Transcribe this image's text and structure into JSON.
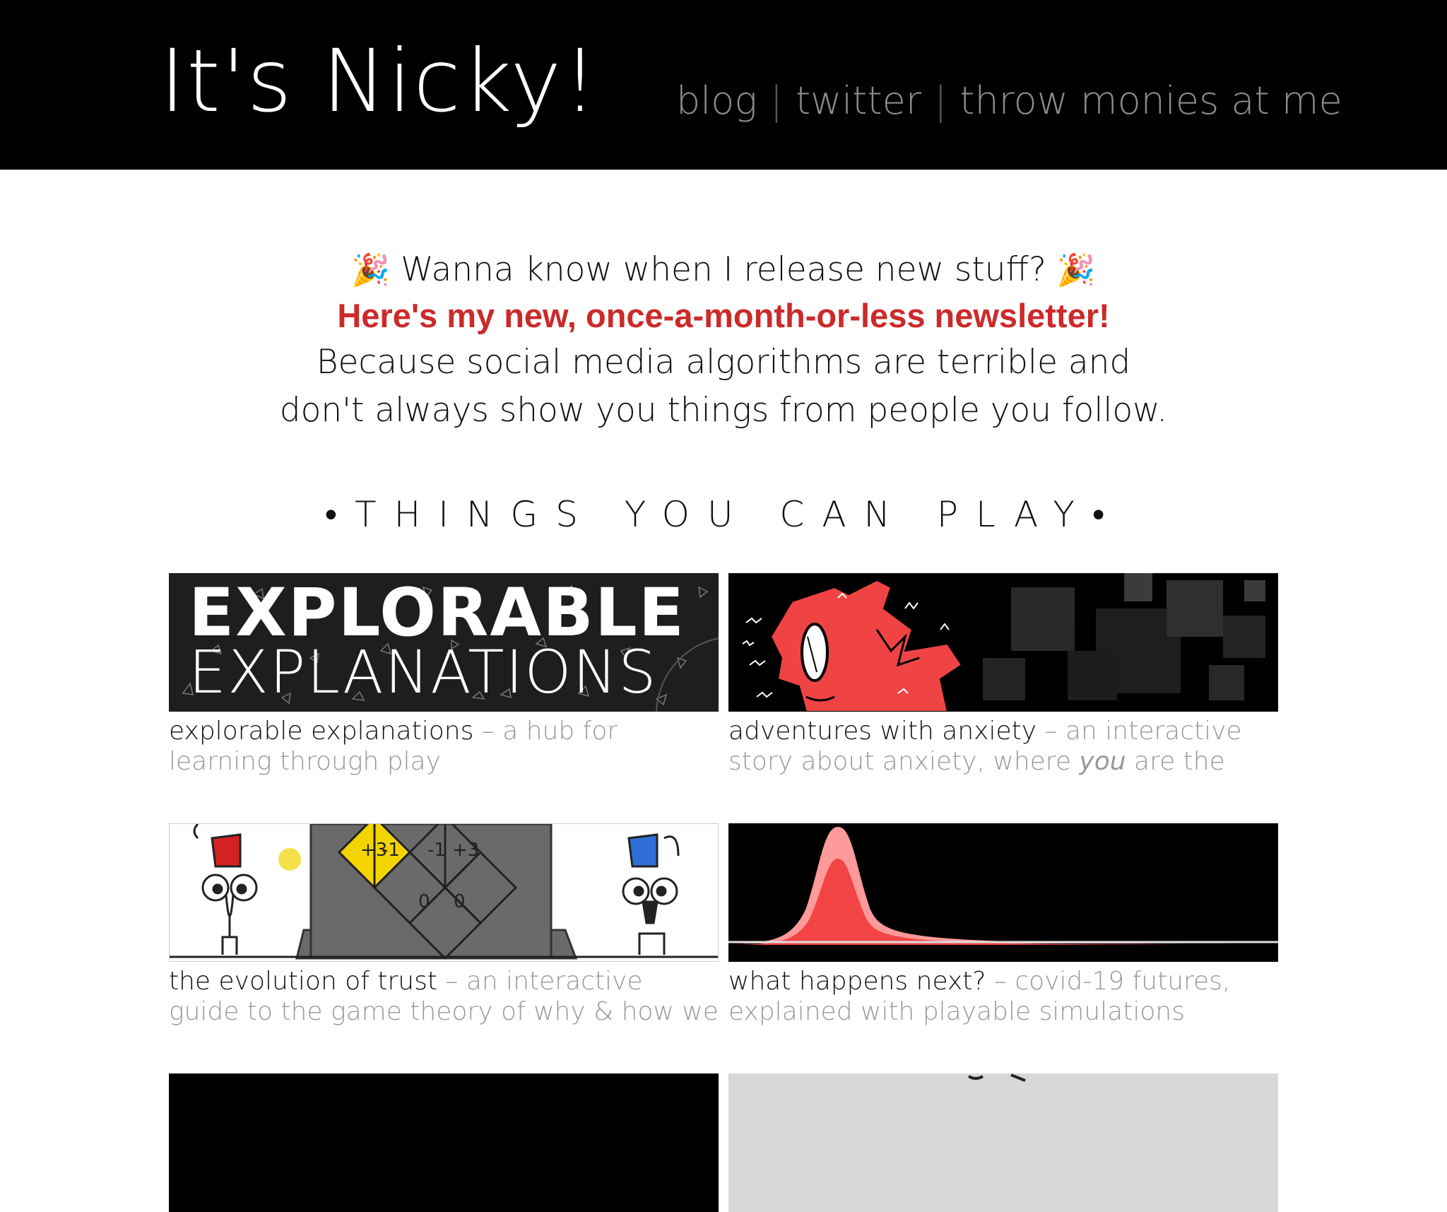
{
  "header": {
    "site_title": "It's Nicky!",
    "nav": {
      "blog": "blog",
      "twitter": "twitter",
      "donate": "throw monies at me",
      "separator": "|"
    }
  },
  "newsletter": {
    "emoji": "🎉",
    "question": "Wanna know when I release new stuff?",
    "link_text": "Here's my new, once-a-month-or-less newsletter!",
    "body": "Because social media algorithms are terrible and don't always show you things from people you follow."
  },
  "section": {
    "heading": "•THINGS YOU CAN PLAY•"
  },
  "cards": [
    {
      "name": "explorable explanations",
      "desc": "– a hub for learning through play",
      "thumb_line1": "EXPLORABLE",
      "thumb_line2": "EXPLANATIONS"
    },
    {
      "name": "adventures with anxiety",
      "desc_before": "– an interactive story about anxiety, where ",
      "desc_em": "you",
      "desc_after": " are the anxiety"
    },
    {
      "name": "the evolution of trust",
      "desc": "– an interactive guide to the game theory of why & how we trust each other",
      "thumb_labels": [
        "+3",
        "-1",
        "-1",
        "+3",
        "0",
        "0"
      ]
    },
    {
      "name": "what happens next?",
      "desc": "– covid-19 futures, explained with playable simulations"
    },
    {
      "name": "",
      "desc": ""
    },
    {
      "name": "",
      "desc": ""
    }
  ],
  "colors": {
    "header_bg": "#000000",
    "accent_red": "#cc2a2a",
    "nav_gray": "#8c8c8c",
    "desc_gray": "#999999"
  }
}
